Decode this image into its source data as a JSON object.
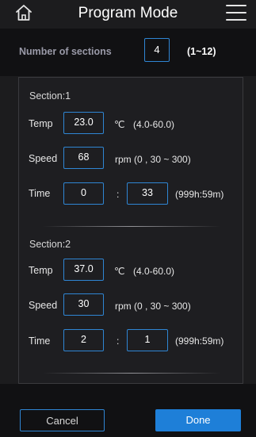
{
  "header": {
    "title": "Program Mode",
    "home_icon": "home-icon",
    "menu_icon": "hamburger-menu-icon"
  },
  "sections_setting": {
    "label": "Number of sections",
    "value": "4",
    "range": "(1~12)"
  },
  "sections": [
    {
      "title": "Section:1",
      "temp": {
        "label": "Temp",
        "value": "23.0",
        "unit": "℃",
        "range": "(4.0-60.0)"
      },
      "speed": {
        "label": "Speed",
        "value": "68",
        "unit_range": "rpm (0 , 30 ~ 300)"
      },
      "time": {
        "label": "Time",
        "hours": "0",
        "separator": ":",
        "minutes": "33",
        "range": "(999h:59m)"
      }
    },
    {
      "title": "Section:2",
      "temp": {
        "label": "Temp",
        "value": "37.0",
        "unit": "℃",
        "range": "(4.0-60.0)"
      },
      "speed": {
        "label": "Speed",
        "value": "30",
        "unit_range": "rpm (0 , 30 ~ 300)"
      },
      "time": {
        "label": "Time",
        "hours": "2",
        "separator": ":",
        "minutes": "1",
        "range": "(999h:59m)"
      }
    }
  ],
  "footer": {
    "cancel_label": "Cancel",
    "done_label": "Done"
  },
  "colors": {
    "accent": "#2f86d4",
    "primary_button": "#1e7fd8",
    "background": "#1c1c1e",
    "panel": "#1e1e21"
  }
}
